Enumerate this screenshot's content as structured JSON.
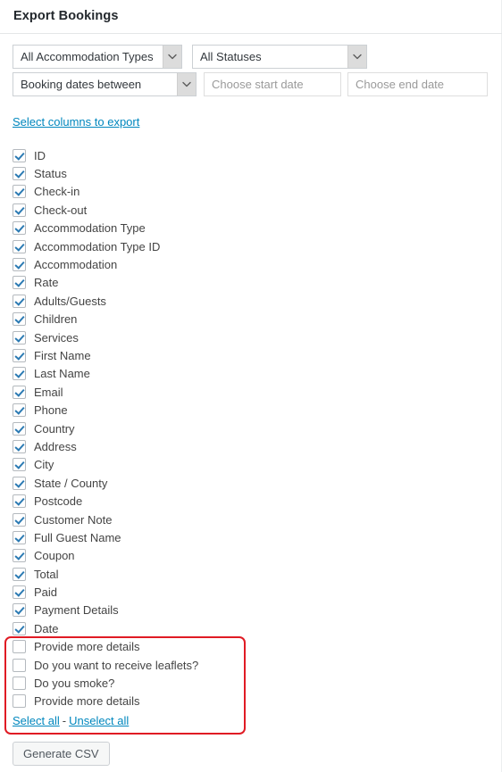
{
  "page": {
    "title": "Export Bookings"
  },
  "filters": {
    "accommodation_type": {
      "selected": "All Accommodation Types",
      "icon": "chevron-down-icon"
    },
    "status": {
      "selected": "All Statuses",
      "icon": "chevron-down-icon"
    },
    "date_mode": {
      "selected": "Booking dates between",
      "icon": "chevron-down-icon"
    },
    "start_date": {
      "value": "",
      "placeholder": "Choose start date"
    },
    "end_date": {
      "value": "",
      "placeholder": "Choose end date"
    }
  },
  "columns_section": {
    "toggle_link": "Select columns to export",
    "items": [
      {
        "label": "ID",
        "checked": true
      },
      {
        "label": "Status",
        "checked": true
      },
      {
        "label": "Check-in",
        "checked": true
      },
      {
        "label": "Check-out",
        "checked": true
      },
      {
        "label": "Accommodation Type",
        "checked": true
      },
      {
        "label": "Accommodation Type ID",
        "checked": true
      },
      {
        "label": "Accommodation",
        "checked": true
      },
      {
        "label": "Rate",
        "checked": true
      },
      {
        "label": "Adults/Guests",
        "checked": true
      },
      {
        "label": "Children",
        "checked": true
      },
      {
        "label": "Services",
        "checked": true
      },
      {
        "label": "First Name",
        "checked": true
      },
      {
        "label": "Last Name",
        "checked": true
      },
      {
        "label": "Email",
        "checked": true
      },
      {
        "label": "Phone",
        "checked": true
      },
      {
        "label": "Country",
        "checked": true
      },
      {
        "label": "Address",
        "checked": true
      },
      {
        "label": "City",
        "checked": true
      },
      {
        "label": "State / County",
        "checked": true
      },
      {
        "label": "Postcode",
        "checked": true
      },
      {
        "label": "Customer Note",
        "checked": true
      },
      {
        "label": "Full Guest Name",
        "checked": true
      },
      {
        "label": "Coupon",
        "checked": true
      },
      {
        "label": "Total",
        "checked": true
      },
      {
        "label": "Paid",
        "checked": true
      },
      {
        "label": "Payment Details",
        "checked": true
      },
      {
        "label": "Date",
        "checked": true
      },
      {
        "label": "Provide more details",
        "checked": false
      },
      {
        "label": "Do you want to receive leaflets?",
        "checked": false
      },
      {
        "label": "Do you smoke?",
        "checked": false
      },
      {
        "label": "Provide more details",
        "checked": false
      }
    ],
    "select_all": "Select all",
    "separator": "-",
    "unselect_all": "Unselect all"
  },
  "actions": {
    "generate_csv": "Generate CSV"
  },
  "annotation": {
    "color": "#e01b24"
  }
}
